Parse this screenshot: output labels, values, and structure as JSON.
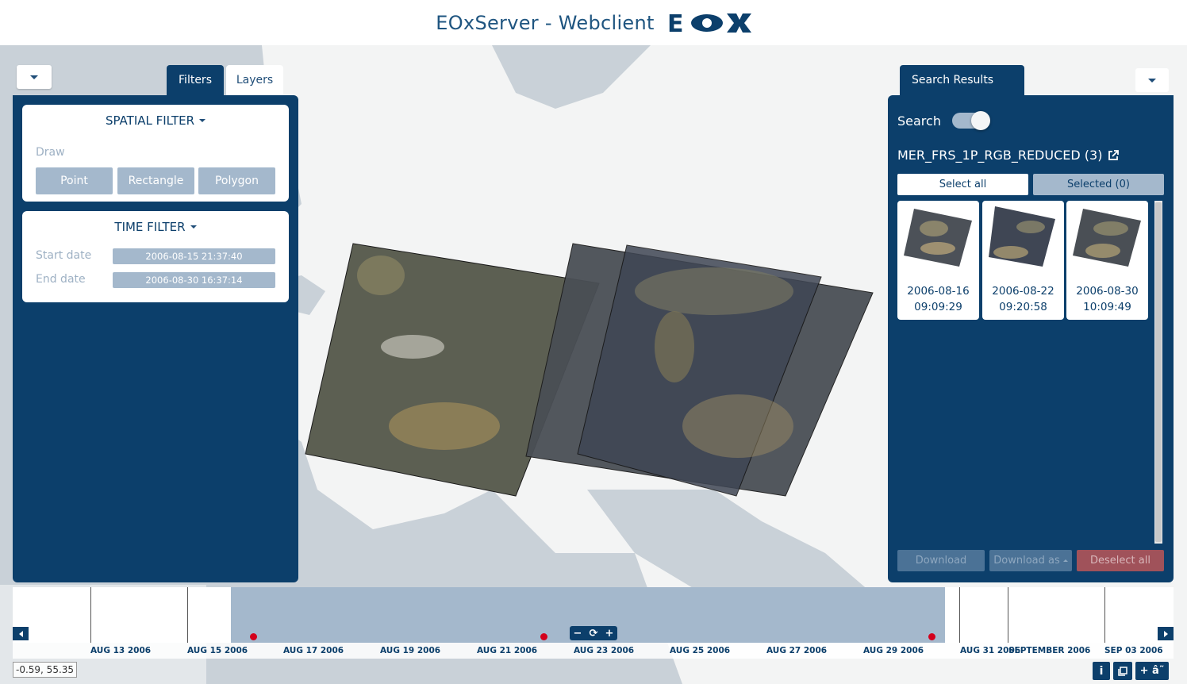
{
  "header": {
    "title": "EOxServer - Webclient",
    "logo_text": "EOX"
  },
  "tabs": {
    "filters": "Filters",
    "layers": "Layers",
    "search_results": "Search Results"
  },
  "spatial_filter": {
    "title": "SPATIAL FILTER",
    "draw_label": "Draw",
    "buttons": [
      "Point",
      "Rectangle",
      "Polygon"
    ]
  },
  "time_filter": {
    "title": "TIME FILTER",
    "start_label": "Start date",
    "start_value": "2006-08-15 21:37:40",
    "end_label": "End date",
    "end_value": "2006-08-30 16:37:14"
  },
  "search_panel": {
    "search_label": "Search",
    "search_enabled": true,
    "collection": "MER_FRS_1P_RGB_REDUCED (3)",
    "select_all": "Select all",
    "selected": "Selected (0)",
    "results": [
      {
        "date": "2006-08-16",
        "time": "09:09:29"
      },
      {
        "date": "2006-08-22",
        "time": "09:20:58"
      },
      {
        "date": "2006-08-30",
        "time": "10:09:49"
      }
    ],
    "download": "Download",
    "download_as": "Download as",
    "deselect_all": "Deselect all"
  },
  "timeline": {
    "labels": [
      "AUG 13 2006",
      "AUG 15 2006",
      "AUG 17 2006",
      "AUG 19 2006",
      "AUG 21 2006",
      "AUG 23 2006",
      "AUG 25 2006",
      "AUG 27 2006",
      "AUG 29 2006",
      "AUG 31 2006",
      "SEPTEMBER 2006",
      "SEP 03 2006"
    ],
    "controls": {
      "zoom_out": "−",
      "reload": "⟳",
      "zoom_in": "+"
    }
  },
  "coordinates": "-0.59, 55.35",
  "bottom_buttons": {
    "info": "i",
    "book": "📘",
    "attribution": "+ â˜"
  },
  "colors": {
    "primary": "#0c3f6b",
    "muted": "#a4b8cc",
    "dot": "#d3001c",
    "danger": "#a0525a"
  }
}
